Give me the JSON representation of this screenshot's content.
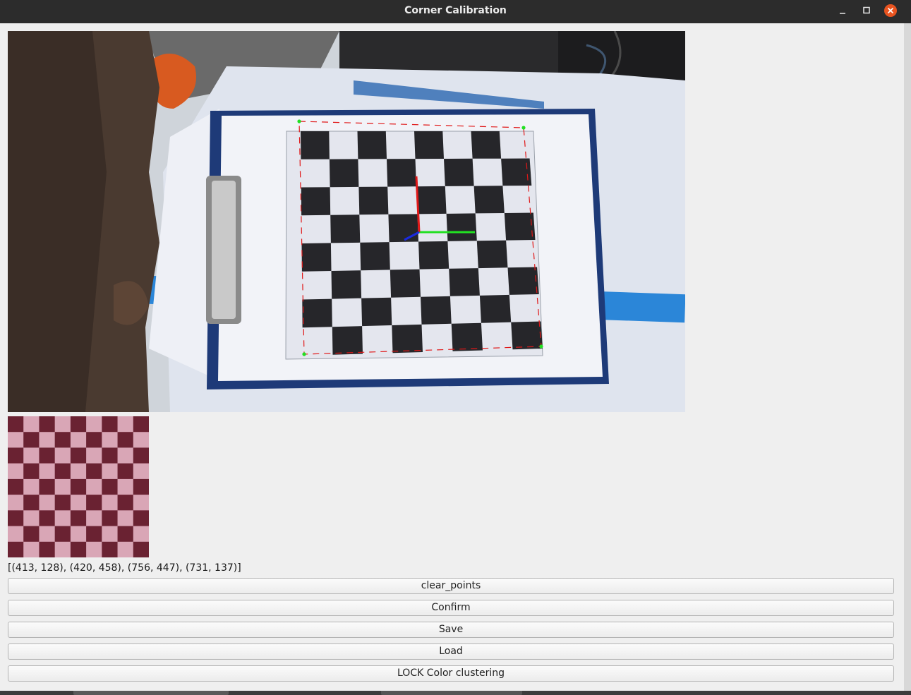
{
  "window": {
    "title": "Corner Calibration"
  },
  "points_text": "[(413, 128), (420, 458), (756, 447), (731, 137)]",
  "buttons": {
    "clear": "clear_points",
    "confirm": "Confirm",
    "save": "Save",
    "load": "Load",
    "lock": "LOCK Color clustering"
  },
  "overlay": {
    "corner_marker_color": "#22e022",
    "outline_color": "#e01818",
    "axis_x_color": "#22e022",
    "axis_y_color": "#e01818",
    "axis_z_color": "#1a2ae0"
  },
  "icons": {
    "minimize": "minimize-icon",
    "maximize": "maximize-icon",
    "close": "close-icon"
  }
}
